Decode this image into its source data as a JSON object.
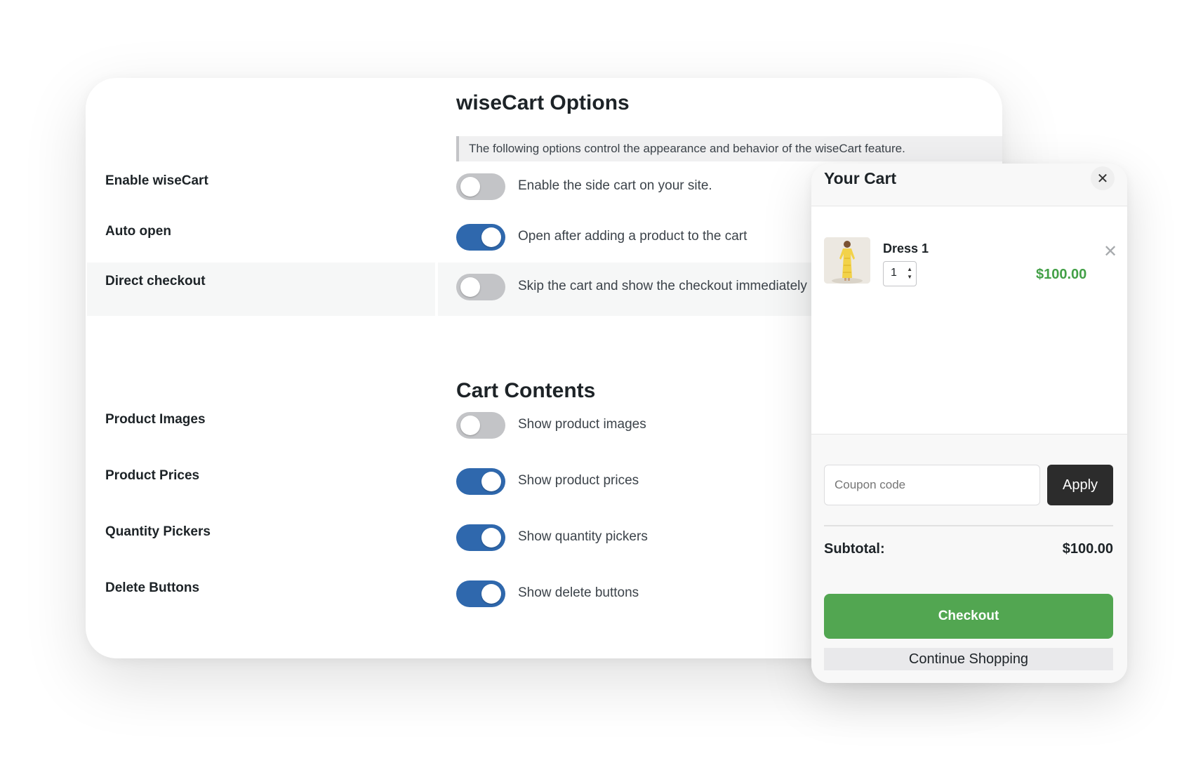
{
  "settings": {
    "title": "wiseCart Options",
    "description": "The following options control the appearance and behavior of the wiseCart feature.",
    "general_options": [
      {
        "label": "Enable wiseCart",
        "text": "Enable the side cart on your site.",
        "enabled": false
      },
      {
        "label": "Auto open",
        "text": "Open after adding a product to the cart",
        "enabled": true
      },
      {
        "label": "Direct checkout",
        "text": "Skip the cart and show the checkout immediately",
        "enabled": false
      }
    ],
    "contents_title": "Cart Contents",
    "contents_options": [
      {
        "label": "Product Images",
        "text": "Show product images",
        "enabled": false
      },
      {
        "label": "Product Prices",
        "text": "Show product prices",
        "enabled": true
      },
      {
        "label": "Quantity Pickers",
        "text": "Show quantity pickers",
        "enabled": true
      },
      {
        "label": "Delete Buttons",
        "text": "Show delete buttons",
        "enabled": true
      }
    ]
  },
  "cart": {
    "title": "Your Cart",
    "close_icon": "close-icon",
    "item": {
      "name": "Dress 1",
      "quantity": "1",
      "price": "$100.00"
    },
    "coupon_placeholder": "Coupon code",
    "apply_label": "Apply",
    "subtotal_label": "Subtotal:",
    "subtotal_value": "$100.00",
    "checkout_label": "Checkout",
    "continue_label": "Continue Shopping"
  },
  "colors": {
    "toggle_on": "#2f68ad",
    "toggle_off": "#c3c4c7",
    "price_green": "#43a047",
    "checkout_green": "#52a651",
    "apply_dark": "#2c2c2c"
  }
}
